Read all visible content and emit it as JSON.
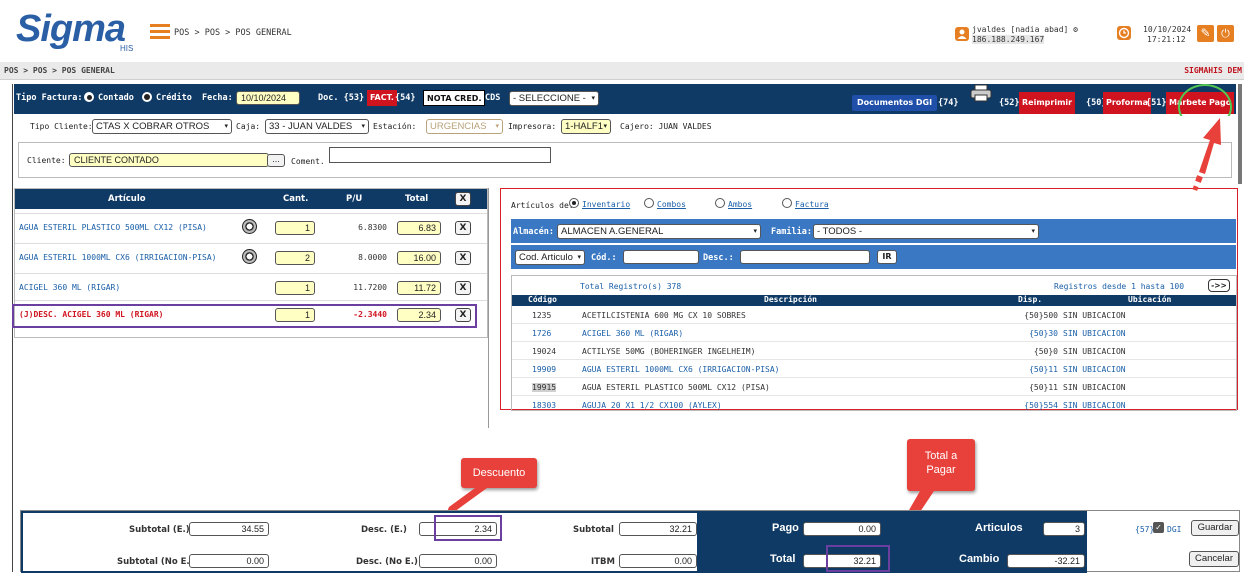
{
  "header": {
    "logo_text": "Sigma",
    "logo_sub": "HIS",
    "breadcrumb_top": "POS > POS > POS GENERAL",
    "user": "jvaldes [nadia abad] ⚙",
    "ip": "186.188.249.167",
    "date": "10/10/2024",
    "time": "17:21:12"
  },
  "subheader": {
    "breadcrumb": "POS > POS > POS GENERAL",
    "brand_right": "SIGMAHIS DEM"
  },
  "toolbar": {
    "tipo_factura_label": "Tipo Factura:",
    "contado_label": "Contado",
    "credito_label": "Crédito",
    "fecha_label": "Fecha:",
    "fecha_value": "10/10/2024",
    "doc_label": "Doc. {53}",
    "fact_button": "FACT.",
    "code54": "{54}",
    "nota_cred_button": "NOTA CRED.",
    "cds_label": "CDS",
    "cds_value": "- SELECCIONE -",
    "documentos_dgi": "Documentos DGI",
    "code74": "{74}",
    "code52": "{52}",
    "reimprimir": "Reimprimir",
    "code50": "{50}",
    "proforma": "Proforma",
    "code51": "{51}",
    "marbete": "Marbete",
    "pago": "Pago"
  },
  "row2": {
    "tipo_cliente_label": "Tipo Cliente:",
    "tipo_cliente_value": "CTAS X COBRAR OTROS",
    "caja_label": "Caja:",
    "caja_value": "33 - JUAN VALDES",
    "estacion_label": "Estación:",
    "estacion_value": "URGENCIAS",
    "impresora_label": "Impresora:",
    "impresora_value": "1-HALF1",
    "cajero": "Cajero: JUAN VALDES"
  },
  "cliente": {
    "label": "Cliente:",
    "value": "CLIENTE CONTADO",
    "ellipsis": "...",
    "coment_label": "Coment."
  },
  "articles": {
    "headers": [
      "Artículo",
      "Cant.",
      "P/U",
      "Total",
      "X"
    ],
    "rows": [
      {
        "name": "AGUA ESTERIL PLASTICO 500ML CX12 (PISA)",
        "qty": "1",
        "pu": "6.8300",
        "total": "6.83",
        "x": "X",
        "coin": true,
        "discount": false
      },
      {
        "name": "AGUA ESTERIL 1000ML CX6 (IRRIGACION-PISA)",
        "qty": "2",
        "pu": "8.0000",
        "total": "16.00",
        "x": "X",
        "coin": true,
        "discount": false
      },
      {
        "name": "ACIGEL 360 ML (RIGAR)",
        "qty": "1",
        "pu": "11.7200",
        "total": "11.72",
        "x": "X",
        "coin": false,
        "discount": false
      },
      {
        "name": "(J)DESC. ACIGEL 360 ML (RIGAR)",
        "qty": "1",
        "pu": "-2.3440",
        "total": "2.34",
        "x": "X",
        "coin": false,
        "discount": true
      }
    ]
  },
  "catalog": {
    "articulos_de": "Artículos de:",
    "options": [
      "Inventario",
      "Combos",
      "Ambos",
      "Factura"
    ],
    "almacen_label": "Almacén:",
    "almacen_value": "ALMACEN A.GENERAL",
    "familia_label": "Familia:",
    "familia_value": "- TODOS -",
    "search_select": "Cod. Articulo",
    "cod_label": "Cód.:",
    "desc_label": "Desc.:",
    "ir_button": "IR",
    "total_registros": "Total Registro(s) 378",
    "registros_rango": "Registros desde 1 hasta 100",
    "next_button": "->>",
    "headers": [
      "Código",
      "Descripción",
      "Disp.",
      "Ubicación"
    ],
    "rows": [
      {
        "code": "1235",
        "desc": "ACETILCISTENIA 600 MG CX 10 SOBRES",
        "disp": "{50}500",
        "ubic": "SIN UBICACION",
        "blue": false
      },
      {
        "code": "1726",
        "desc": "ACIGEL 360 ML (RIGAR)",
        "disp": "{50}30",
        "ubic": "SIN UBICACION",
        "blue": true
      },
      {
        "code": "19024",
        "desc": "ACTILYSE 50MG (BOHERINGER INGELHEIM)",
        "disp": "{50}0",
        "ubic": "SIN UBICACION",
        "blue": false
      },
      {
        "code": "19909",
        "desc": "AGUA ESTERIL 1000ML CX6 (IRRIGACION-PISA)",
        "disp": "{50}11",
        "ubic": "SIN UBICACION",
        "blue": true
      },
      {
        "code": "19915",
        "desc": "AGUA ESTERIL PLASTICO 500ML CX12 (PISA)",
        "disp": "{50}11",
        "ubic": "SIN UBICACION",
        "blue": false
      },
      {
        "code": "18303",
        "desc": "AGUJA 20 X1 1/2 CX100 (AYLEX)",
        "disp": "{50}554",
        "ubic": "SIN UBICACION",
        "blue": true
      }
    ]
  },
  "annotations": {
    "descuento": "Descuento",
    "total_pagar_1": "Total a",
    "total_pagar_2": "Pagar"
  },
  "totals": {
    "subtotal_e_label": "Subtotal (E.)",
    "subtotal_e": "34.55",
    "desc_e_label": "Desc. (E.)",
    "desc_e": "2.34",
    "subtotal_label": "Subtotal",
    "subtotal": "32.21",
    "pago_label": "Pago",
    "pago": "0.00",
    "articulos_label": "Articulos",
    "articulos": "3",
    "code57": "{57}",
    "dgi_label": "DGI",
    "guardar": "Guardar",
    "subtotal_ne_label": "Subtotal (No E.)",
    "subtotal_ne": "0.00",
    "desc_ne_label": "Desc. (No E.)",
    "desc_ne": "0.00",
    "itbm_label": "ITBM",
    "itbm": "0.00",
    "total_label": "Total",
    "total": "32.21",
    "cambio_label": "Cambio",
    "cambio": "-32.21",
    "cancelar": "Cancelar"
  }
}
